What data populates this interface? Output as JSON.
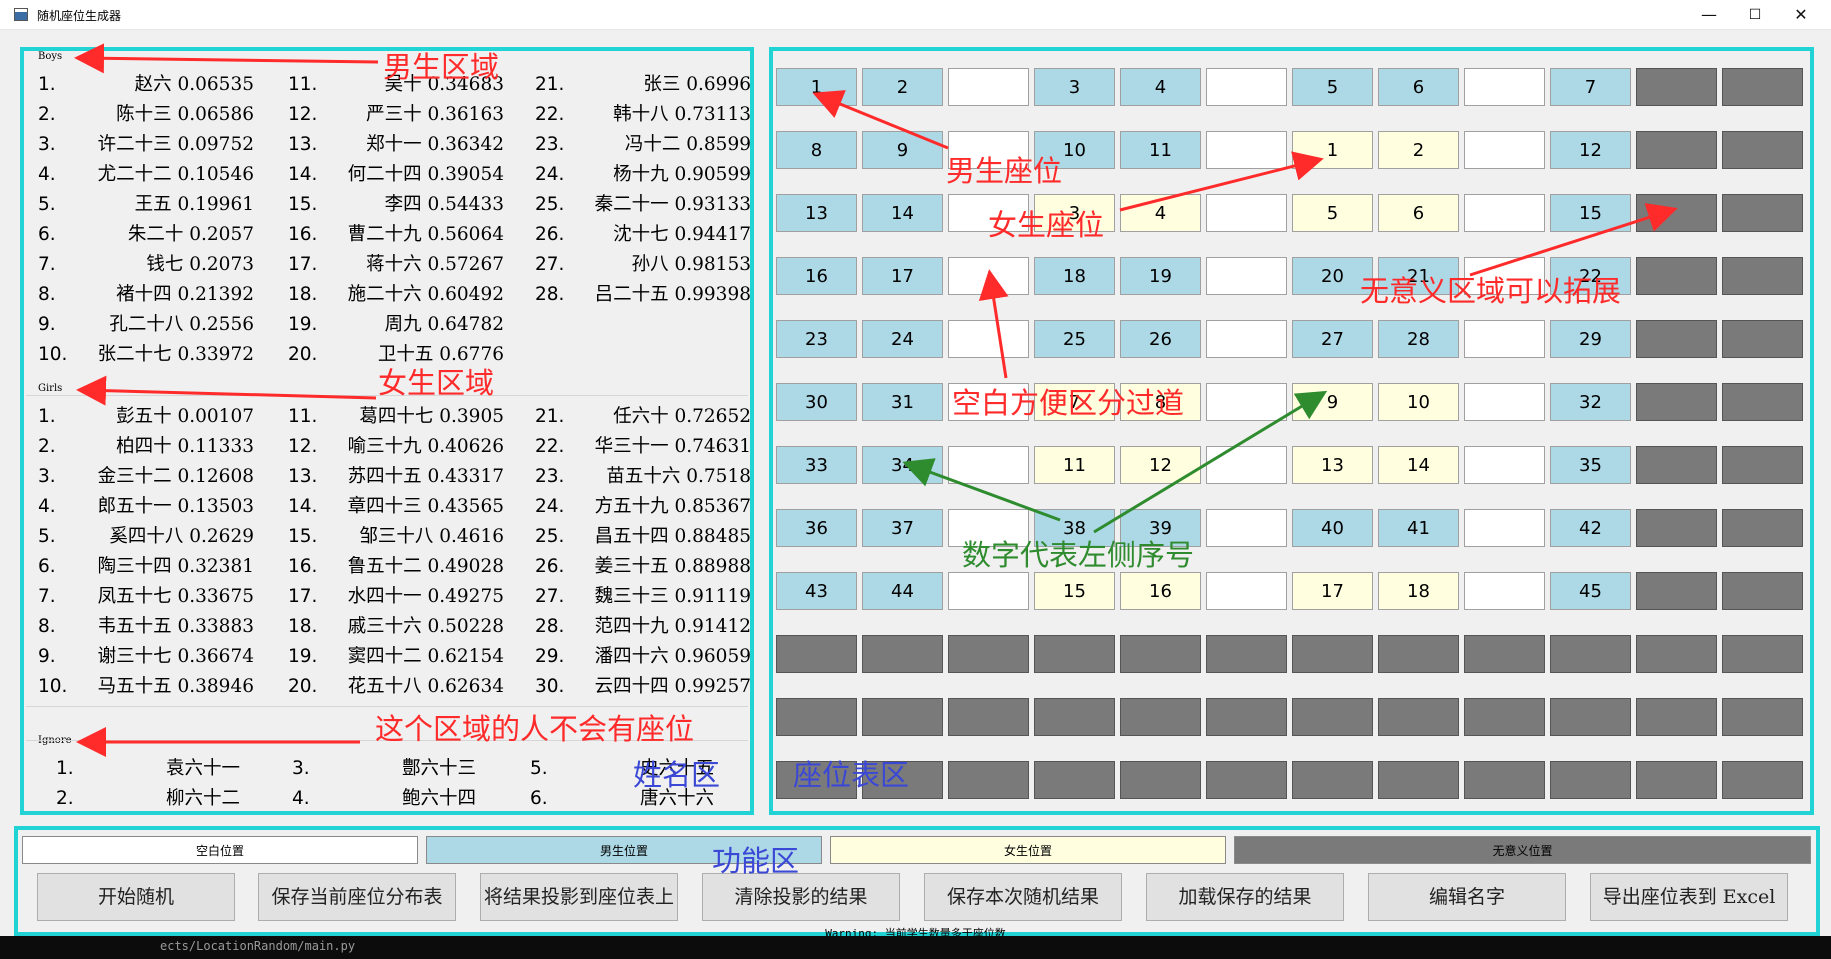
{
  "window": {
    "title": "随机座位生成器",
    "min": "—",
    "max": "☐",
    "close": "✕"
  },
  "names": {
    "boys_label": "Boys",
    "girls_label": "Girls",
    "ignore_label": "Ignore",
    "boys": [
      [
        "1.",
        "赵六 0.06535"
      ],
      [
        "2.",
        "陈十三 0.06586"
      ],
      [
        "3.",
        "许二十三 0.09752"
      ],
      [
        "4.",
        "尤二十二 0.10546"
      ],
      [
        "5.",
        "王五 0.19961"
      ],
      [
        "6.",
        "朱二十 0.2057"
      ],
      [
        "7.",
        "钱七 0.2073"
      ],
      [
        "8.",
        "褚十四 0.21392"
      ],
      [
        "9.",
        "孔二十八 0.2556"
      ],
      [
        "10.",
        "张二十七 0.33972"
      ],
      [
        "11.",
        "吴十 0.34683"
      ],
      [
        "12.",
        "严三十 0.36163"
      ],
      [
        "13.",
        "郑十一 0.36342"
      ],
      [
        "14.",
        "何二十四 0.39054"
      ],
      [
        "15.",
        "李四 0.54433"
      ],
      [
        "16.",
        "曹二十九 0.56064"
      ],
      [
        "17.",
        "蒋十六 0.57267"
      ],
      [
        "18.",
        "施二十六 0.60492"
      ],
      [
        "19.",
        "周九 0.64782"
      ],
      [
        "20.",
        "卫十五 0.6776"
      ],
      [
        "21.",
        "张三 0.6996"
      ],
      [
        "22.",
        "韩十八 0.73113"
      ],
      [
        "23.",
        "冯十二 0.8599"
      ],
      [
        "24.",
        "杨十九 0.90599"
      ],
      [
        "25.",
        "秦二十一 0.93133"
      ],
      [
        "26.",
        "沈十七 0.94417"
      ],
      [
        "27.",
        "孙八 0.98153"
      ],
      [
        "28.",
        "吕二十五 0.99398"
      ]
    ],
    "girls": [
      [
        "1.",
        "彭五十 0.00107"
      ],
      [
        "2.",
        "柏四十 0.11333"
      ],
      [
        "3.",
        "金三十二 0.12608"
      ],
      [
        "4.",
        "郎五十一 0.13503"
      ],
      [
        "5.",
        "奚四十八 0.2629"
      ],
      [
        "6.",
        "陶三十四 0.32381"
      ],
      [
        "7.",
        "凤五十七 0.33675"
      ],
      [
        "8.",
        "韦五十五 0.33883"
      ],
      [
        "9.",
        "谢三十七 0.36674"
      ],
      [
        "10.",
        "马五十五 0.38946"
      ],
      [
        "11.",
        "葛四十七 0.3905"
      ],
      [
        "12.",
        "喻三十九 0.40626"
      ],
      [
        "13.",
        "苏四十五 0.43317"
      ],
      [
        "14.",
        "章四十三 0.43565"
      ],
      [
        "15.",
        "邹三十八 0.4616"
      ],
      [
        "16.",
        "鲁五十二 0.49028"
      ],
      [
        "17.",
        "水四十一 0.49275"
      ],
      [
        "18.",
        "戚三十六 0.50228"
      ],
      [
        "19.",
        "窦四十二 0.62154"
      ],
      [
        "20.",
        "花五十八 0.62634"
      ],
      [
        "21.",
        "任六十 0.72652"
      ],
      [
        "22.",
        "华三十一 0.74631"
      ],
      [
        "23.",
        "苗五十六 0.7518"
      ],
      [
        "24.",
        "方五十九 0.85367"
      ],
      [
        "25.",
        "昌五十四 0.88485"
      ],
      [
        "26.",
        "姜三十五 0.88988"
      ],
      [
        "27.",
        "魏三十三 0.91119"
      ],
      [
        "28.",
        "范四十九 0.91412"
      ],
      [
        "29.",
        "潘四十六 0.96059"
      ],
      [
        "30.",
        "云四十四 0.99257"
      ]
    ],
    "ignore": [
      [
        "1.",
        "袁六十一"
      ],
      [
        "2.",
        "柳六十二"
      ],
      [
        "3.",
        "鄷六十三"
      ],
      [
        "4.",
        "鲍六十四"
      ],
      [
        "5.",
        "史六十五"
      ],
      [
        "6.",
        "唐六十六"
      ]
    ]
  },
  "seats": {
    "rows": [
      [
        [
          "b",
          "1"
        ],
        [
          "b",
          "2"
        ],
        [
          "e",
          ""
        ],
        [
          "b",
          "3"
        ],
        [
          "b",
          "4"
        ],
        [
          "e",
          ""
        ],
        [
          "b",
          "5"
        ],
        [
          "b",
          "6"
        ],
        [
          "e",
          ""
        ],
        [
          "b",
          "7"
        ],
        [
          "n",
          ""
        ],
        [
          "n",
          ""
        ]
      ],
      [
        [
          "b",
          "8"
        ],
        [
          "b",
          "9"
        ],
        [
          "e",
          ""
        ],
        [
          "b",
          "10"
        ],
        [
          "b",
          "11"
        ],
        [
          "e",
          ""
        ],
        [
          "g",
          "1"
        ],
        [
          "g",
          "2"
        ],
        [
          "e",
          ""
        ],
        [
          "b",
          "12"
        ],
        [
          "n",
          ""
        ],
        [
          "n",
          ""
        ]
      ],
      [
        [
          "b",
          "13"
        ],
        [
          "b",
          "14"
        ],
        [
          "e",
          ""
        ],
        [
          "g",
          "3"
        ],
        [
          "g",
          "4"
        ],
        [
          "e",
          ""
        ],
        [
          "g",
          "5"
        ],
        [
          "g",
          "6"
        ],
        [
          "e",
          ""
        ],
        [
          "b",
          "15"
        ],
        [
          "n",
          ""
        ],
        [
          "n",
          ""
        ]
      ],
      [
        [
          "b",
          "16"
        ],
        [
          "b",
          "17"
        ],
        [
          "e",
          ""
        ],
        [
          "b",
          "18"
        ],
        [
          "b",
          "19"
        ],
        [
          "e",
          ""
        ],
        [
          "b",
          "20"
        ],
        [
          "b",
          "21"
        ],
        [
          "e",
          ""
        ],
        [
          "b",
          "22"
        ],
        [
          "n",
          ""
        ],
        [
          "n",
          ""
        ]
      ],
      [
        [
          "b",
          "23"
        ],
        [
          "b",
          "24"
        ],
        [
          "e",
          ""
        ],
        [
          "b",
          "25"
        ],
        [
          "b",
          "26"
        ],
        [
          "e",
          ""
        ],
        [
          "b",
          "27"
        ],
        [
          "b",
          "28"
        ],
        [
          "e",
          ""
        ],
        [
          "b",
          "29"
        ],
        [
          "n",
          ""
        ],
        [
          "n",
          ""
        ]
      ],
      [
        [
          "b",
          "30"
        ],
        [
          "b",
          "31"
        ],
        [
          "e",
          ""
        ],
        [
          "g",
          "7"
        ],
        [
          "g",
          "8"
        ],
        [
          "e",
          ""
        ],
        [
          "g",
          "9"
        ],
        [
          "g",
          "10"
        ],
        [
          "e",
          ""
        ],
        [
          "b",
          "32"
        ],
        [
          "n",
          ""
        ],
        [
          "n",
          ""
        ]
      ],
      [
        [
          "b",
          "33"
        ],
        [
          "b",
          "34"
        ],
        [
          "e",
          ""
        ],
        [
          "g",
          "11"
        ],
        [
          "g",
          "12"
        ],
        [
          "e",
          ""
        ],
        [
          "g",
          "13"
        ],
        [
          "g",
          "14"
        ],
        [
          "e",
          ""
        ],
        [
          "b",
          "35"
        ],
        [
          "n",
          ""
        ],
        [
          "n",
          ""
        ]
      ],
      [
        [
          "b",
          "36"
        ],
        [
          "b",
          "37"
        ],
        [
          "e",
          ""
        ],
        [
          "b",
          "38"
        ],
        [
          "b",
          "39"
        ],
        [
          "e",
          ""
        ],
        [
          "b",
          "40"
        ],
        [
          "b",
          "41"
        ],
        [
          "e",
          ""
        ],
        [
          "b",
          "42"
        ],
        [
          "n",
          ""
        ],
        [
          "n",
          ""
        ]
      ],
      [
        [
          "b",
          "43"
        ],
        [
          "b",
          "44"
        ],
        [
          "e",
          ""
        ],
        [
          "g",
          "15"
        ],
        [
          "g",
          "16"
        ],
        [
          "e",
          ""
        ],
        [
          "g",
          "17"
        ],
        [
          "g",
          "18"
        ],
        [
          "e",
          ""
        ],
        [
          "b",
          "45"
        ],
        [
          "n",
          ""
        ],
        [
          "n",
          ""
        ]
      ],
      [
        [
          "n",
          ""
        ],
        [
          "n",
          ""
        ],
        [
          "n",
          ""
        ],
        [
          "n",
          ""
        ],
        [
          "n",
          ""
        ],
        [
          "n",
          ""
        ],
        [
          "n",
          ""
        ],
        [
          "n",
          ""
        ],
        [
          "n",
          ""
        ],
        [
          "n",
          ""
        ],
        [
          "n",
          ""
        ],
        [
          "n",
          ""
        ]
      ],
      [
        [
          "n",
          ""
        ],
        [
          "n",
          ""
        ],
        [
          "n",
          ""
        ],
        [
          "n",
          ""
        ],
        [
          "n",
          ""
        ],
        [
          "n",
          ""
        ],
        [
          "n",
          ""
        ],
        [
          "n",
          ""
        ],
        [
          "n",
          ""
        ],
        [
          "n",
          ""
        ],
        [
          "n",
          ""
        ],
        [
          "n",
          ""
        ]
      ],
      [
        [
          "n",
          ""
        ],
        [
          "n",
          ""
        ],
        [
          "n",
          ""
        ],
        [
          "n",
          ""
        ],
        [
          "n",
          ""
        ],
        [
          "n",
          ""
        ],
        [
          "n",
          ""
        ],
        [
          "n",
          ""
        ],
        [
          "n",
          ""
        ],
        [
          "n",
          ""
        ],
        [
          "n",
          ""
        ],
        [
          "n",
          ""
        ]
      ]
    ]
  },
  "legend": {
    "empty": "空白位置",
    "boy": "男生位置",
    "girl": "女生位置",
    "none": "无意义位置"
  },
  "buttons": [
    "开始随机",
    "保存当前座位分布表",
    "将结果投影到座位表上",
    "清除投影的结果",
    "保存本次随机结果",
    "加载保存的结果",
    "编辑名字",
    "导出座位表到 Excel"
  ],
  "warning": "Warning: 当前学生数量多于座位数",
  "terminal_text": "ects/LocationRandom/main.py",
  "annotations": {
    "boys_area": "男生区域",
    "girls_area": "女生区域",
    "ignore_area": "这个区域的人不会有座位",
    "name_area": "姓名区",
    "seat_area": "座位表区",
    "function_area": "功能区",
    "boy_seat": "男生座位",
    "girl_seat": "女生座位",
    "aisle": "空白方便区分过道",
    "extend": "无意义区域可以拓展",
    "number_meaning": "数字代表左侧序号"
  },
  "colors": {
    "boy": "#add8e6",
    "girl": "#ffffe0",
    "empty": "#ffffff",
    "none": "#7a7a7a",
    "panel_border": "#22d3d6",
    "annotation_red": "#ff2a2a",
    "annotation_green": "#2e8b2e",
    "annotation_blue": "#3b48d6"
  }
}
